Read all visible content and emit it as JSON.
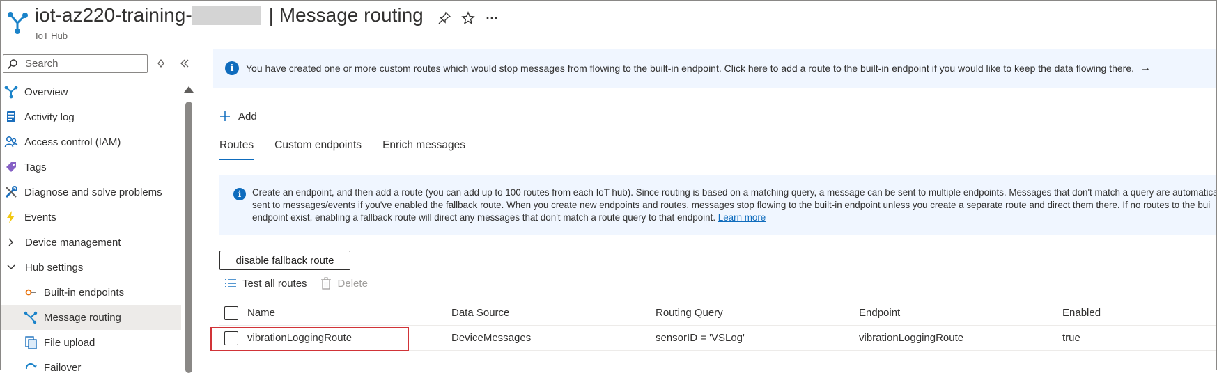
{
  "header": {
    "title_prefix": "iot-az220-training-",
    "title_suffix": "| Message routing",
    "subtitle": "IoT Hub"
  },
  "sidebar": {
    "search_placeholder": "Search",
    "items": [
      {
        "label": "Overview",
        "icon": "overview-icon"
      },
      {
        "label": "Activity log",
        "icon": "activity-log-icon"
      },
      {
        "label": "Access control (IAM)",
        "icon": "access-control-icon"
      },
      {
        "label": "Tags",
        "icon": "tag-icon"
      },
      {
        "label": "Diagnose and solve problems",
        "icon": "wrench-icon"
      },
      {
        "label": "Events",
        "icon": "lightning-icon"
      },
      {
        "label": "Device management",
        "icon": "chevron-right-icon"
      },
      {
        "label": "Hub settings",
        "icon": "chevron-down-icon"
      },
      {
        "label": "Built-in endpoints",
        "icon": "endpoint-icon"
      },
      {
        "label": "Message routing",
        "icon": "routing-icon"
      },
      {
        "label": "File upload",
        "icon": "file-upload-icon"
      },
      {
        "label": "Failover",
        "icon": "failover-icon"
      }
    ]
  },
  "banner_top": {
    "text": "You have created one or more custom routes which would stop messages from flowing to the built-in endpoint.  Click here to add a route to the built-in endpoint if you would like to keep the data flowing there.",
    "arrow": "→"
  },
  "add_label": "Add",
  "tabs": [
    "Routes",
    "Custom endpoints",
    "Enrich messages"
  ],
  "banner_info": {
    "line1": "Create an endpoint, and then add a route (you can add up to 100 routes from each IoT hub). Since routing is based on a matching query, a message can be sent to multiple endpoints. Messages that don't match a query are automatica",
    "line2": "sent to messages/events if you've enabled the fallback route. When you create new endpoints and routes, messages stop flowing to the built-in endpoint unless you create a separate route and direct them there. If no routes to the bui",
    "line3": "endpoint exist, enabling a fallback route will direct any messages that don't match a route query to that endpoint.",
    "link": "Learn more"
  },
  "fallback_button": "disable fallback route",
  "toolbar": {
    "test_label": "Test all routes",
    "delete_label": "Delete"
  },
  "table": {
    "columns": [
      "Name",
      "Data Source",
      "Routing Query",
      "Endpoint",
      "Enabled"
    ],
    "rows": [
      {
        "name": "vibrationLoggingRoute",
        "source": "DeviceMessages",
        "query": "sensorID = 'VSLog'",
        "endpoint": "vibrationLoggingRoute",
        "enabled": "true"
      }
    ]
  },
  "colors": {
    "accent": "#0f6cbd",
    "highlight": "#d13438",
    "banner_bg": "#f0f6ff",
    "selected_bg": "#edebe9"
  }
}
